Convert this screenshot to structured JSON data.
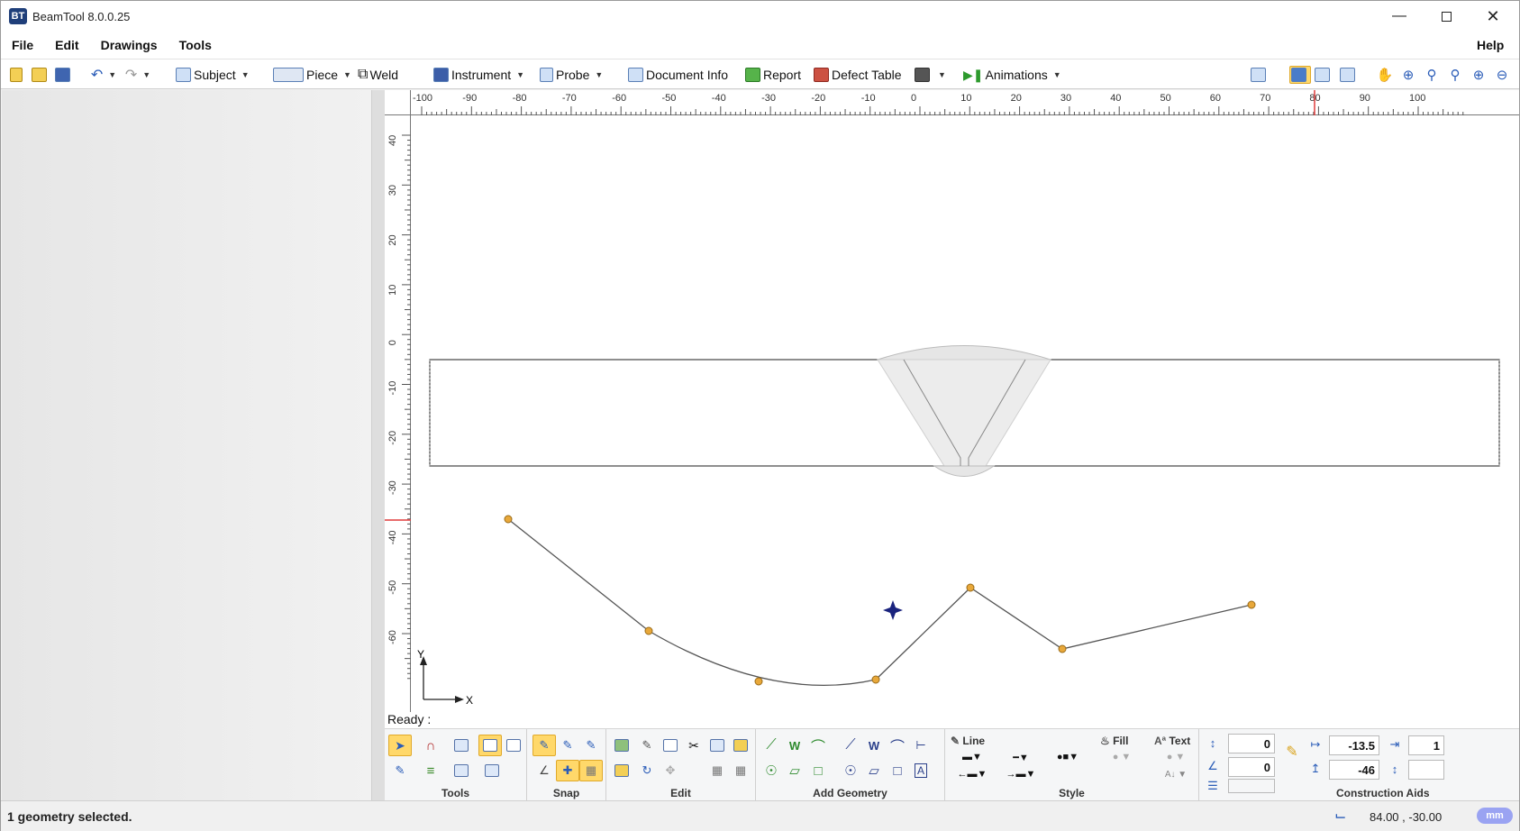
{
  "window": {
    "app_icon": "BT",
    "title": "BeamTool 8.0.0.25",
    "minimize_icon": "minimize-icon",
    "maximize_icon": "maximize-icon",
    "close_icon": "close-icon"
  },
  "menu": {
    "file": "File",
    "edit": "Edit",
    "drawings": "Drawings",
    "tools": "Tools",
    "help": "Help"
  },
  "toolbar": {
    "subject": "Subject",
    "piece": "Piece",
    "weld": "Weld",
    "instrument": "Instrument",
    "probe": "Probe",
    "document_info": "Document Info",
    "report": "Report",
    "defect_table": "Defect Table",
    "animations": "Animations"
  },
  "ruler": {
    "horizontal": [
      "-100",
      "-90",
      "-80",
      "-70",
      "-60",
      "-50",
      "-40",
      "-30",
      "-20",
      "-10",
      "0",
      "10",
      "20",
      "30",
      "40",
      "50",
      "60",
      "70",
      "80",
      "90",
      "100"
    ],
    "vertical": [
      "40",
      "30",
      "20",
      "10",
      "0",
      "-10",
      "-20",
      "-30",
      "-40",
      "-50",
      "-60"
    ]
  },
  "axes": {
    "x": "X",
    "y": "Y"
  },
  "status": {
    "ready": "Ready :",
    "selection": "1 geometry selected.",
    "coordinates": "84.00 , -30.00",
    "unit": "mm"
  },
  "ribbon": {
    "tools": "Tools",
    "snap": "Snap",
    "edit": "Edit",
    "add_geometry": "Add Geometry",
    "style": "Style",
    "construction_aids": "Construction Aids",
    "line_label": "Line",
    "fill_label": "Fill",
    "text_label": "Text",
    "field_a": "0",
    "field_b": "0",
    "field_x": "-13.5",
    "field_y": "-46",
    "field_w": "1",
    "field_h": ""
  },
  "colors": {
    "accent_selected": "#ffd86a",
    "geometry_line": "#555555",
    "vertex": "#e8a83a",
    "weld_fill": "#e6e6e6",
    "ruler_marker": "#e03c3c"
  }
}
